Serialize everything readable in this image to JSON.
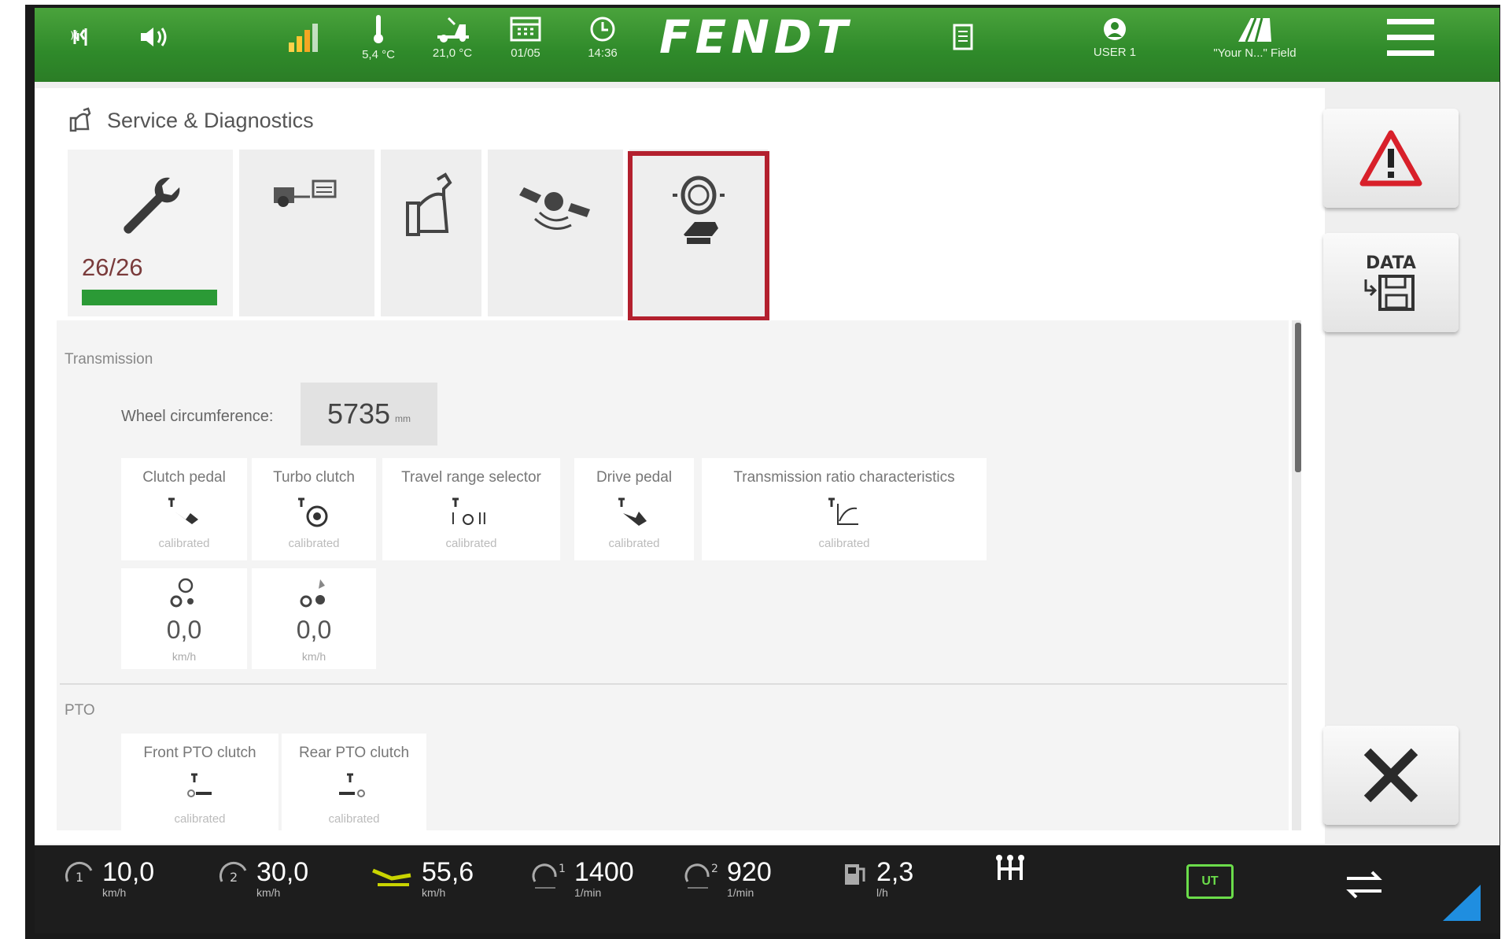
{
  "topbar": {
    "temperature_outside": "5,4 °C",
    "temperature_inside": "21,0 °C",
    "date": "01/05",
    "time": "14:36",
    "brand": "FENDT",
    "user": "USER 1",
    "field": "\"Your N...\" Field",
    "icons": [
      "signal-icon",
      "volume-icon",
      "network-strength-icon",
      "thermometer-icon",
      "tractor-temp-icon",
      "calendar-icon",
      "clock-icon",
      "document-icon",
      "user-icon",
      "field-icon",
      "menu-icon"
    ]
  },
  "page": {
    "title": "Service & Diagnostics",
    "tabs": [
      {
        "icon": "wrench-icon",
        "count": "26/26",
        "progress": 1.0
      },
      {
        "icon": "machine-computer-icon"
      },
      {
        "icon": "hand-wrench-icon"
      },
      {
        "icon": "satellite-icon"
      },
      {
        "icon": "steering-sensor-icon",
        "highlighted": true
      }
    ]
  },
  "transmission": {
    "section_label": "Transmission",
    "wheel_label": "Wheel circumference:",
    "wheel_value": "5735",
    "wheel_unit": "mm",
    "cards": [
      {
        "label": "Clutch pedal",
        "status": "calibrated"
      },
      {
        "label": "Turbo clutch",
        "status": "calibrated"
      },
      {
        "label": "Travel range selector",
        "status": "calibrated"
      },
      {
        "label": "Drive pedal",
        "status": "calibrated"
      },
      {
        "label": "Transmission ratio characteristics",
        "status": "calibrated"
      }
    ],
    "speeds": [
      {
        "value": "0,0",
        "unit": "km/h"
      },
      {
        "value": "0,0",
        "unit": "km/h"
      }
    ]
  },
  "pto": {
    "section_label": "PTO",
    "cards": [
      {
        "label": "Front PTO clutch",
        "status": "calibrated"
      },
      {
        "label": "Rear PTO clutch",
        "status": "calibrated"
      }
    ]
  },
  "side_buttons": {
    "data_label": "DATA"
  },
  "bottombar": {
    "speed1": {
      "value": "10,0",
      "unit": "km/h"
    },
    "speed2": {
      "value": "30,0",
      "unit": "km/h"
    },
    "ground_speed": {
      "value": "55,6",
      "unit": "km/h"
    },
    "engine1": {
      "value": "1400",
      "unit": "1/min"
    },
    "engine2": {
      "value": "920",
      "unit": "1/min"
    },
    "fuel": {
      "value": "2,3",
      "unit": "l/h"
    },
    "ut_label": "UT"
  },
  "colors": {
    "green_bar": "#3a9633",
    "highlight": "#b3202e",
    "warning_red": "#d8202a"
  }
}
